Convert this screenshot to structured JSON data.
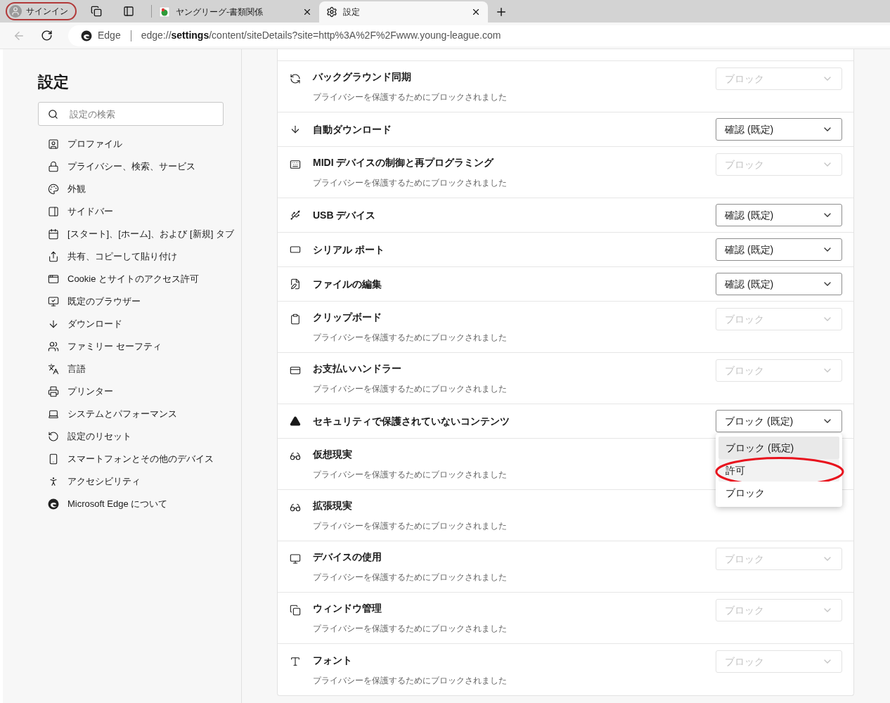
{
  "tab_strip": {
    "profile_button": "サインイン",
    "tabs": [
      {
        "title": "ヤングリーグ-書類関係",
        "selected": false,
        "kind": "site"
      },
      {
        "title": "設定",
        "selected": true,
        "kind": "settings"
      }
    ]
  },
  "address_bar": {
    "site_label": "Edge",
    "url_prefix": "edge://",
    "url_bold": "settings",
    "url_rest": "/content/siteDetails?site=http%3A%2F%2Fwww.young-league.com"
  },
  "sidebar": {
    "title": "設定",
    "search": {
      "placeholder": "設定の検索"
    },
    "items": [
      {
        "label": "プロファイル"
      },
      {
        "label": "プライバシー、検索、サービス"
      },
      {
        "label": "外観"
      },
      {
        "label": "サイドバー"
      },
      {
        "label": "[スタート]、[ホーム]、および [新規] タブ"
      },
      {
        "label": "共有、コピーして貼り付け"
      },
      {
        "label": "Cookie とサイトのアクセス許可"
      },
      {
        "label": "既定のブラウザー"
      },
      {
        "label": "ダウンロード"
      },
      {
        "label": "ファミリー セーフティ"
      },
      {
        "label": "言語"
      },
      {
        "label": "プリンター"
      },
      {
        "label": "システムとパフォーマンス"
      },
      {
        "label": "設定のリセット"
      },
      {
        "label": "スマートフォンとその他のデバイス"
      },
      {
        "label": "アクセシビリティ"
      },
      {
        "label": "Microsoft Edge について"
      }
    ]
  },
  "permissions": [
    {
      "title": "バックグラウンド同期",
      "subtitle": "プライバシーを保護するためにブロックされました",
      "value": "ブロック",
      "disabled": true
    },
    {
      "title": "自動ダウンロード",
      "value": "確認 (既定)",
      "disabled": false
    },
    {
      "title": "MIDI デバイスの制御と再プログラミング",
      "subtitle": "プライバシーを保護するためにブロックされました",
      "value": "ブロック",
      "disabled": true
    },
    {
      "title": "USB デバイス",
      "value": "確認 (既定)",
      "disabled": false
    },
    {
      "title": "シリアル ポート",
      "value": "確認 (既定)",
      "disabled": false
    },
    {
      "title": "ファイルの編集",
      "value": "確認 (既定)",
      "disabled": false
    },
    {
      "title": "クリップボード",
      "subtitle": "プライバシーを保護するためにブロックされました",
      "value": "ブロック",
      "disabled": true
    },
    {
      "title": "お支払いハンドラー",
      "subtitle": "プライバシーを保護するためにブロックされました",
      "value": "ブロック",
      "disabled": true
    },
    {
      "title": "セキュリティで保護されていないコンテンツ",
      "value": "ブロック (既定)",
      "disabled": false,
      "open": true,
      "options": [
        {
          "label": "ブロック (既定)",
          "selected": true,
          "hovered": false,
          "circled": false
        },
        {
          "label": "許可",
          "selected": false,
          "hovered": true,
          "circled": true
        },
        {
          "label": "ブロック",
          "selected": false,
          "hovered": false,
          "circled": false
        }
      ]
    },
    {
      "title": "仮想現実",
      "subtitle": "プライバシーを保護するためにブロックされました"
    },
    {
      "title": "拡張現実",
      "subtitle": "プライバシーを保護するためにブロックされました"
    },
    {
      "title": "デバイスの使用",
      "subtitle": "プライバシーを保護するためにブロックされました",
      "value": "ブロック",
      "disabled": true
    },
    {
      "title": "ウィンドウ管理",
      "subtitle": "プライバシーを保護するためにブロックされました",
      "value": "ブロック",
      "disabled": true
    },
    {
      "title": "フォント",
      "subtitle": "プライバシーを保護するためにブロックされました",
      "value": "ブロック",
      "disabled": true
    }
  ]
}
